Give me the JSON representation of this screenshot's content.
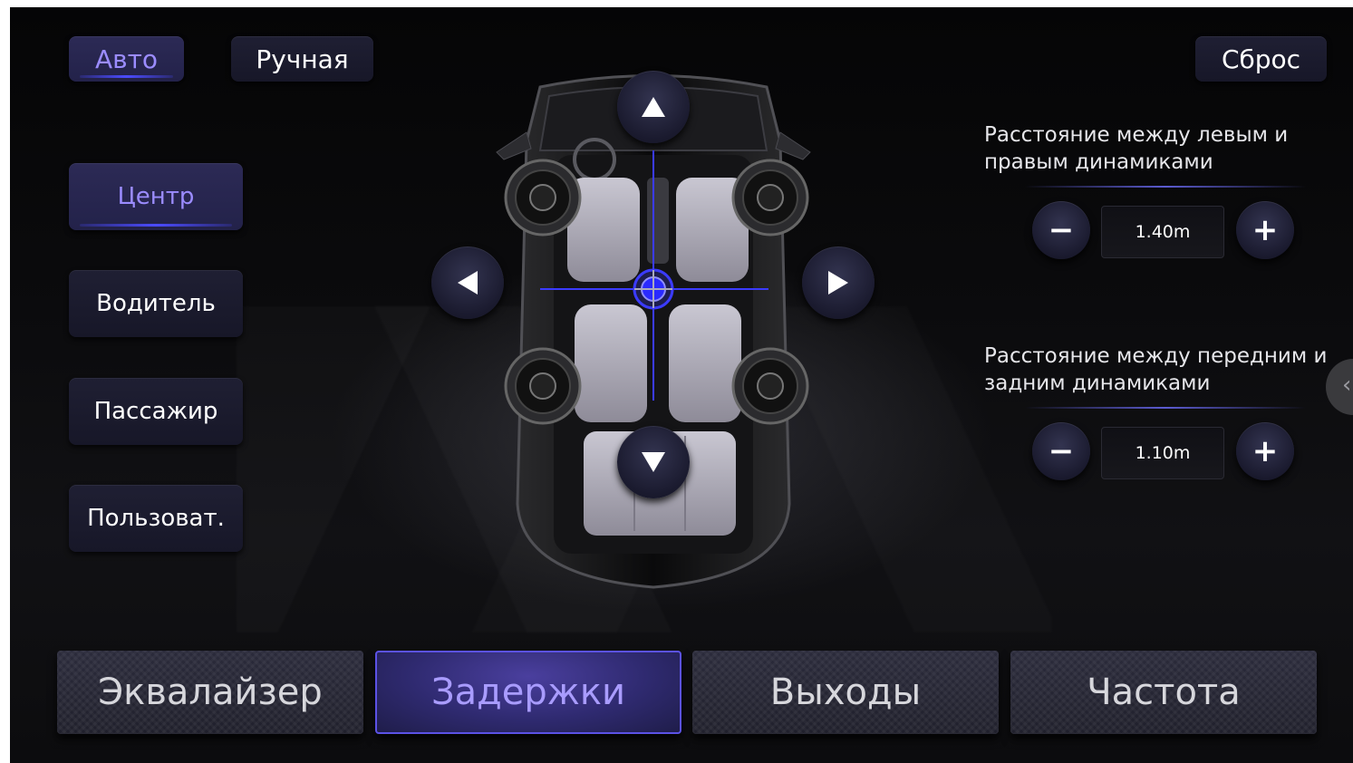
{
  "mode_buttons": {
    "auto": "Авто",
    "manual": "Ручная",
    "reset": "Сброс"
  },
  "presets": [
    "Центр",
    "Водитель",
    "Пассажир",
    "Пользоват."
  ],
  "distance_lr": {
    "label": "Расстояние между левым и правым динамиками",
    "value": "1.40m",
    "minus": "−",
    "plus": "+"
  },
  "distance_fr": {
    "label": "Расстояние между передним и задним динамиками",
    "value": "1.10m",
    "minus": "−",
    "plus": "+"
  },
  "tabs": [
    "Эквалайзер",
    "Задержки",
    "Выходы",
    "Частота"
  ],
  "colors": {
    "accent": "#9b8cff",
    "crosshair": "#3b3bff",
    "background": "#0b0b0d"
  },
  "icons": [
    "arrow-up-icon",
    "arrow-down-icon",
    "arrow-left-icon",
    "arrow-right-icon",
    "speaker-icon",
    "listening-point-icon",
    "chevron-left-icon"
  ]
}
